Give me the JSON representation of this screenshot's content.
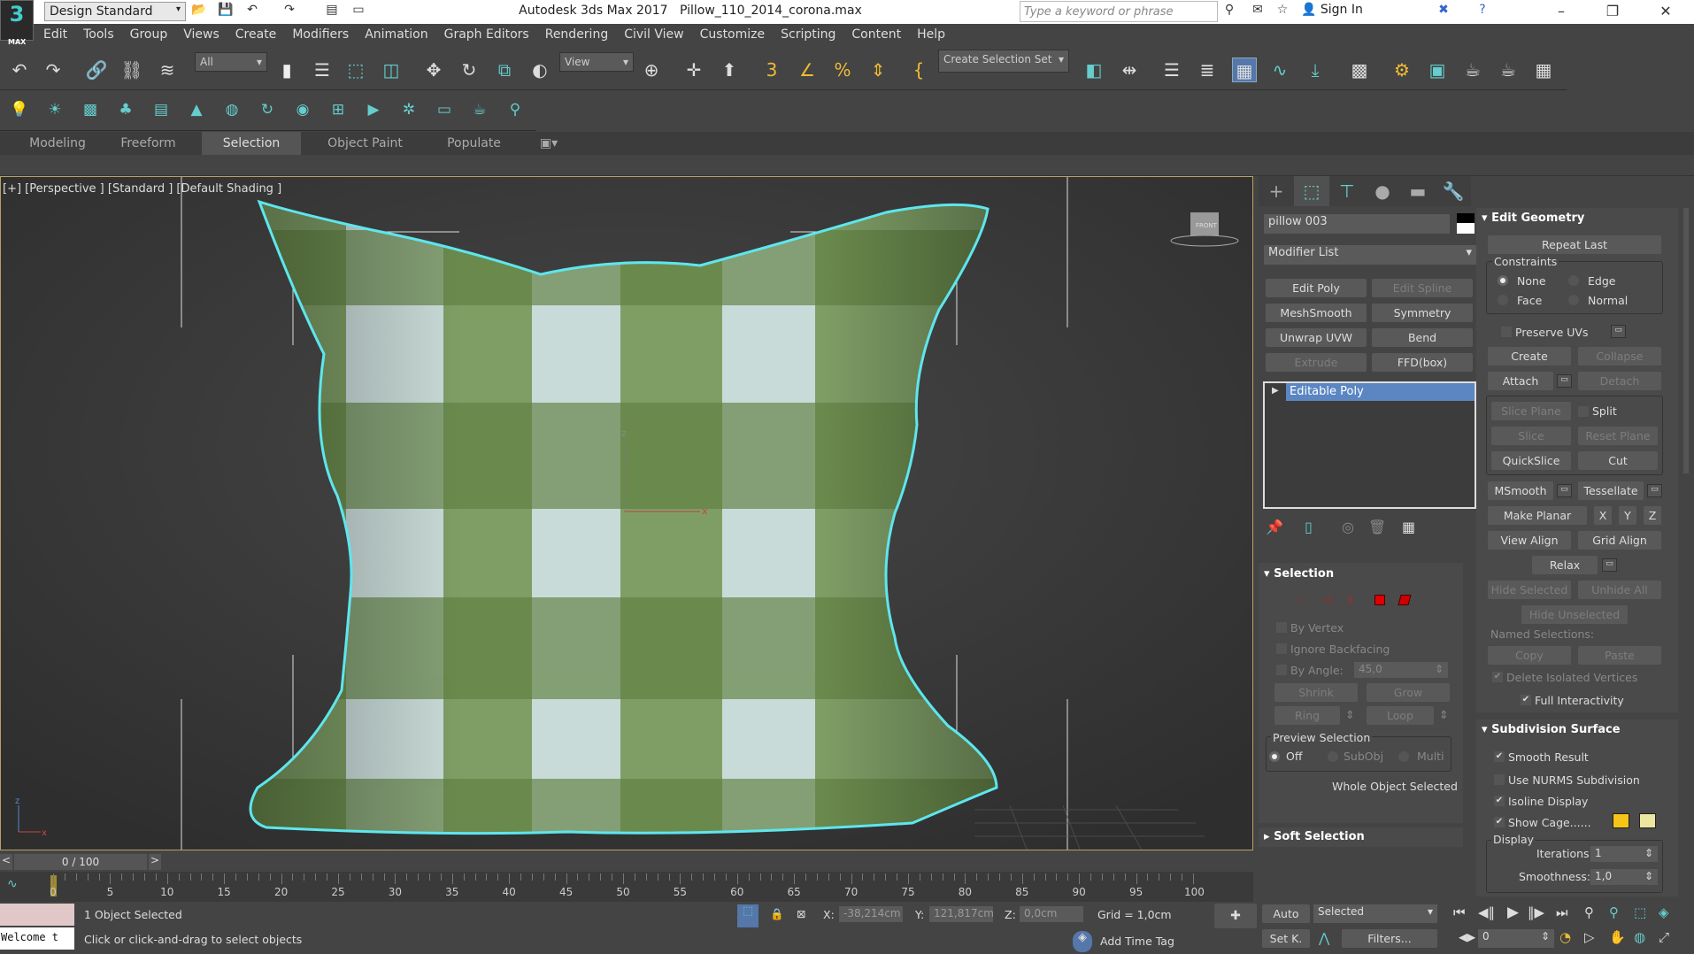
{
  "titlebar": {
    "logo": "3",
    "logo_sub": "MAX",
    "workspace": "Design Standard",
    "app": "Autodesk 3ds Max 2017",
    "file": "Pillow_110_2014_corona.max",
    "search_placeholder": "Type a keyword or phrase",
    "sign_in": "Sign In"
  },
  "menu": [
    "Edit",
    "Tools",
    "Group",
    "Views",
    "Create",
    "Modifiers",
    "Animation",
    "Graph Editors",
    "Rendering",
    "Civil View",
    "Customize",
    "Scripting",
    "Content",
    "Help"
  ],
  "toolbar": {
    "filter": "All",
    "ref_coord": "View",
    "selection_set": "Create Selection Set"
  },
  "ribbon": {
    "tabs": [
      "Modeling",
      "Freeform",
      "Selection",
      "Object Paint",
      "Populate"
    ],
    "active": "Selection"
  },
  "viewport": {
    "label": "[+] [Perspective ] [Standard ] [Default Shading ]",
    "viewcube": "FRONT",
    "gizmo_x": "x",
    "gizmo_z": "z",
    "axis_x": "x",
    "axis_z": "z"
  },
  "command_panel": {
    "object_name": "pillow 003",
    "modifier_list": "Modifier List",
    "modifier_buttons": [
      {
        "label": "Edit Poly",
        "enabled": true
      },
      {
        "label": "Edit Spline",
        "enabled": false
      },
      {
        "label": "MeshSmooth",
        "enabled": true
      },
      {
        "label": "Symmetry",
        "enabled": true
      },
      {
        "label": "Unwrap UVW",
        "enabled": true
      },
      {
        "label": "Bend",
        "enabled": true
      },
      {
        "label": "Extrude",
        "enabled": false
      },
      {
        "label": "FFD(box)",
        "enabled": true
      }
    ],
    "stack": [
      "Editable Poly"
    ],
    "selection": {
      "title": "Selection",
      "by_vertex": "By Vertex",
      "ignore_backfacing": "Ignore Backfacing",
      "by_angle": "By Angle:",
      "angle": "45,0",
      "shrink": "Shrink",
      "grow": "Grow",
      "ring": "Ring",
      "loop": "Loop",
      "preview": "Preview Selection",
      "off": "Off",
      "subobj": "SubObj",
      "multi": "Multi",
      "status": "Whole Object Selected"
    },
    "soft_selection": "Soft Selection",
    "edit_geometry": {
      "title": "Edit Geometry",
      "repeat_last": "Repeat Last",
      "constraints": "Constraints",
      "none": "None",
      "edge": "Edge",
      "face": "Face",
      "normal": "Normal",
      "preserve_uvs": "Preserve UVs",
      "create": "Create",
      "collapse": "Collapse",
      "attach": "Attach",
      "detach": "Detach",
      "slice_plane": "Slice Plane",
      "split": "Split",
      "slice": "Slice",
      "reset_plane": "Reset Plane",
      "quickslice": "QuickSlice",
      "cut": "Cut",
      "msmooth": "MSmooth",
      "tessellate": "Tessellate",
      "make_planar": "Make Planar",
      "x": "X",
      "y": "Y",
      "z": "Z",
      "view_align": "View Align",
      "grid_align": "Grid Align",
      "relax": "Relax",
      "hide_selected": "Hide Selected",
      "unhide_all": "Unhide All",
      "hide_unselected": "Hide Unselected",
      "named_selections": "Named Selections:",
      "copy": "Copy",
      "paste": "Paste",
      "delete_isolated": "Delete Isolated Vertices",
      "full_interactivity": "Full Interactivity"
    },
    "subdivision": {
      "title": "Subdivision Surface",
      "smooth_result": "Smooth Result",
      "use_nurms": "Use NURMS Subdivision",
      "isoline": "Isoline Display",
      "show_cage": "Show Cage......",
      "display": "Display",
      "iterations_label": "Iterations:",
      "iterations": "1",
      "smoothness_label": "Smoothness:",
      "smoothness": "1,0"
    },
    "colors": {
      "cage1": "#f5c518",
      "cage2": "#ece6a0"
    }
  },
  "timeline": {
    "frame": "0 / 100",
    "ticks": [
      "0",
      "5",
      "10",
      "15",
      "20",
      "25",
      "30",
      "35",
      "40",
      "45",
      "50",
      "55",
      "60",
      "65",
      "70",
      "75",
      "80",
      "85",
      "90",
      "95",
      "100"
    ]
  },
  "status": {
    "maxscript": "Welcome t",
    "selected": "1 Object Selected",
    "prompt": "Click or click-and-drag to select objects",
    "x_label": "X:",
    "x": "-38,214cm",
    "y_label": "Y:",
    "y": "121,817cm",
    "z_label": "Z:",
    "z": "0,0cm",
    "grid": "Grid = 1,0cm",
    "add_time_tag": "Add Time Tag"
  },
  "animation": {
    "auto": "Auto",
    "set_key": "Set K.",
    "key_filter": "Selected",
    "filters": "Filters...",
    "frame": "0"
  }
}
